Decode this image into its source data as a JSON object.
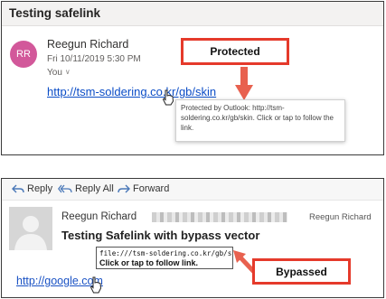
{
  "panel1": {
    "subject": "Testing safelink",
    "avatar_initials": "RR",
    "sender": "Reegun Richard",
    "date": "Fri 10/11/2019 5:30 PM",
    "to": "You",
    "link": "http://tsm-soldering.co.kr/gb/skin",
    "callout": "Protected",
    "tooltip": "Protected by Outlook: http://tsm-soldering.co.kr/gb/skin. Click or tap to follow the link.",
    "colors": {
      "avatar": "#d2589a",
      "link": "#0b4dc7",
      "callout_border": "#e53a2b"
    }
  },
  "panel2": {
    "toolbar": {
      "reply": "Reply",
      "reply_all": "Reply All",
      "forward": "Forward"
    },
    "sender": "Reegun Richard",
    "sender_right": "Reegun Richard",
    "subject": "Testing Safelink with bypass vector",
    "tooltip_url": "file:///tsm-soldering.co.kr/gb/skin",
    "tooltip_hint": "Click or tap to follow link.",
    "link": "http://google.com",
    "callout": "Bypassed",
    "icons": [
      "reply-icon",
      "reply-all-icon",
      "forward-icon",
      "avatar-placeholder-icon",
      "hand-cursor-icon"
    ]
  }
}
